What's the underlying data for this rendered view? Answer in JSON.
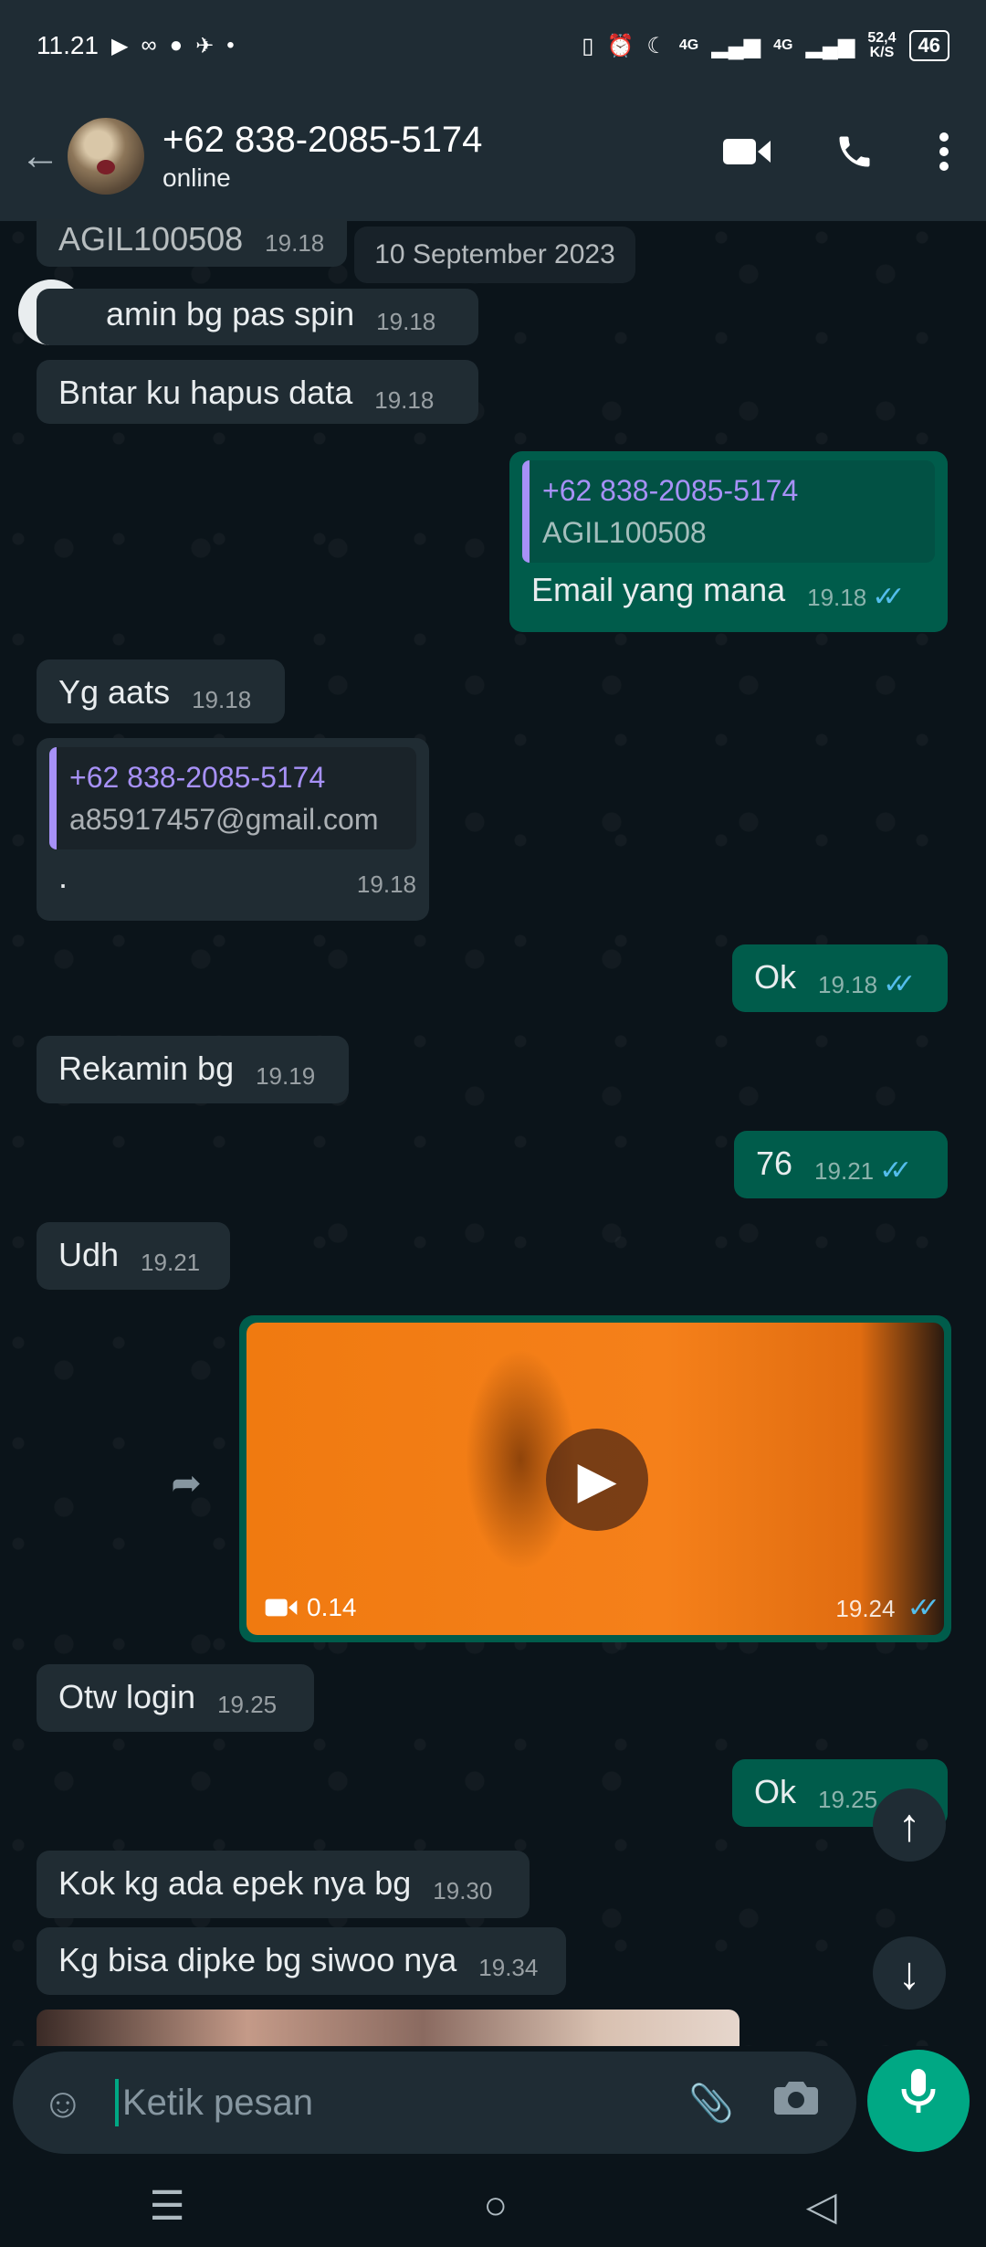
{
  "status_bar": {
    "time": "11.21",
    "net1": "4G",
    "net2": "4G",
    "speed": "52,4\nK/S",
    "battery": "46"
  },
  "header": {
    "back_icon": "arrow-left-icon",
    "contact_name": "+62 838-2085-5174",
    "contact_status": "online"
  },
  "date_chip": "10 September 2023",
  "messages": [
    {
      "dir": "in",
      "text": "AGIL100508",
      "time": "19.18"
    },
    {
      "dir": "in",
      "text": "amin bg pas spin",
      "time": "19.18"
    },
    {
      "dir": "in",
      "text": "Bntar ku hapus data",
      "time": "19.18"
    },
    {
      "dir": "out",
      "quote_name": "+62 838-2085-5174",
      "quote_text": "AGIL100508",
      "text": "Email yang mana",
      "time": "19.18"
    },
    {
      "dir": "in",
      "text": "Yg aats",
      "time": "19.18"
    },
    {
      "dir": "in",
      "quote_name": "+62 838-2085-5174",
      "quote_text": "a85917457@gmail.com",
      "text": ".",
      "time": "19.18"
    },
    {
      "dir": "out",
      "text": "Ok",
      "time": "19.18"
    },
    {
      "dir": "in",
      "text": "Rekamin bg",
      "time": "19.19"
    },
    {
      "dir": "out",
      "text": "76",
      "time": "19.21"
    },
    {
      "dir": "in",
      "text": "Udh",
      "time": "19.21"
    },
    {
      "dir": "out",
      "type": "video",
      "duration": "0.14",
      "time": "19.24"
    },
    {
      "dir": "in",
      "text": "Otw login",
      "time": "19.25"
    },
    {
      "dir": "out",
      "text": "Ok",
      "time": "19.25"
    },
    {
      "dir": "in",
      "text": "Kok kg ada epek nya bg",
      "time": "19.30"
    },
    {
      "dir": "in",
      "text": "Kg bisa dipke bg siwoo nya",
      "time": "19.34"
    }
  ],
  "composer": {
    "placeholder": "Ketik pesan"
  },
  "colors": {
    "incoming_bubble": "#202c33",
    "outgoing_bubble": "#005c4b",
    "accent": "#00a884",
    "read_ticks": "#53bdeb",
    "quote_name": "#a791f7"
  }
}
